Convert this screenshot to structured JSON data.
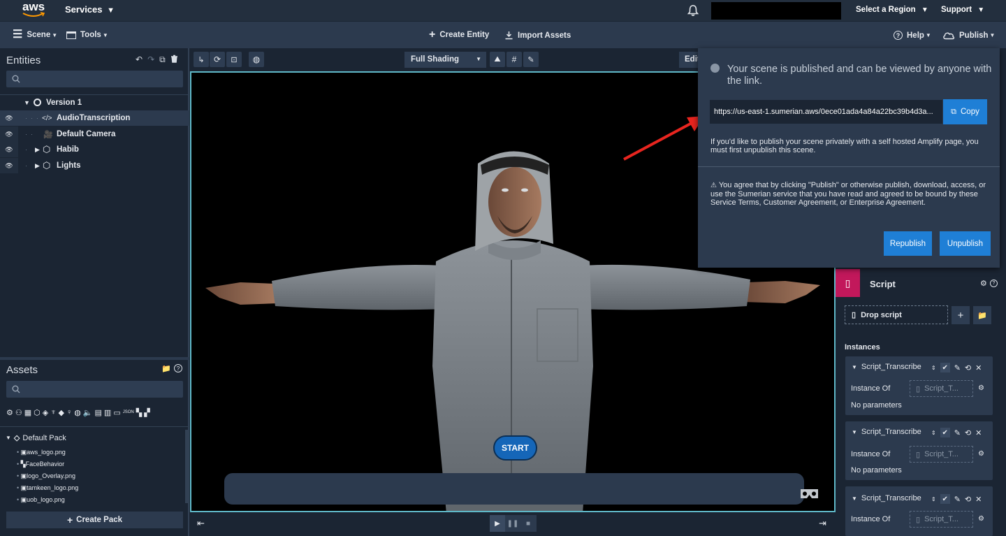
{
  "topbar": {
    "logo_text": "aws",
    "services_label": "Services",
    "region_label": "Select a Region",
    "support_label": "Support"
  },
  "toolbar": {
    "scene_label": "Scene",
    "tools_label": "Tools",
    "create_entity_label": "Create Entity",
    "import_assets_label": "Import Assets",
    "help_label": "Help",
    "publish_label": "Publish"
  },
  "entities": {
    "title": "Entities",
    "root": "Version 1",
    "items": [
      {
        "label": "AudioTranscription",
        "icon": "code-icon"
      },
      {
        "label": "Default Camera",
        "icon": "camera-icon"
      },
      {
        "label": "Habib",
        "icon": "hexagon-icon"
      },
      {
        "label": "Lights",
        "icon": "hexagon-icon"
      }
    ]
  },
  "viewport": {
    "shading_label": "Full Shading",
    "edit_label": "Edit",
    "start_label": "START"
  },
  "assets": {
    "title": "Assets",
    "pack_label": "Default Pack",
    "create_pack_label": "Create Pack",
    "files": [
      "aws_logo.png",
      "FaceBehavior",
      "logo_Overlay.png",
      "tamkeen_logo.png",
      "uob_logo.png"
    ]
  },
  "publish_popup": {
    "message": "Your scene is published and can be viewed by anyone with the link.",
    "link": "https://us-east-1.sumerian.aws/0ece01ada4a84a22bc39b4d3a...",
    "copy_label": "Copy",
    "note": "If you'd like to publish your scene privately with a self hosted Amplify page, you must first unpublish this scene.",
    "agreement": "You agree that by clicking \"Publish\" or otherwise publish, download, access, or use the Sumerian service that you have read and agreed to be bound by these Service Terms, Customer Agreement, or Enterprise Agreement.",
    "republish_label": "Republish",
    "unpublish_label": "Unpublish"
  },
  "script_panel": {
    "title": "Script",
    "drop_label": "Drop script",
    "instances_label": "Instances",
    "instance_name": "Script_Transcribe",
    "instance_of_label": "Instance Of",
    "instance_of_value": "Script_T...",
    "no_params": "No parameters"
  },
  "colors": {
    "accent": "#1f7fd6",
    "viewport_border": "#5fb8c8",
    "script_badge": "#c2185b",
    "arrow": "#e8251f"
  }
}
